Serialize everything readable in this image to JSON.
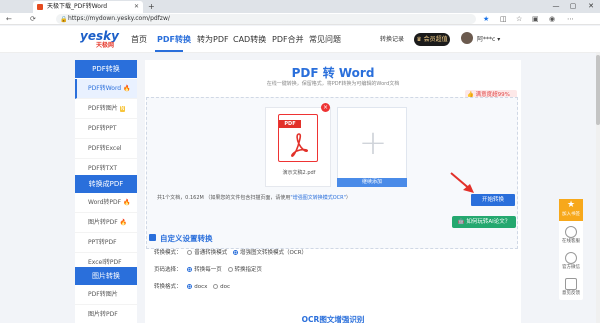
{
  "browser": {
    "tab_title": "天极下载_PDF转Word",
    "url": "https://mydown.yesky.com/pdfzw/",
    "new_tab_symbol": "+",
    "back_symbol": "←",
    "refresh_symbol": "⟳",
    "win_min": "—",
    "win_max": "▢",
    "win_close": "✕"
  },
  "logo": {
    "main": "yesky",
    "sub": "天极网"
  },
  "nav": {
    "items": [
      "首页",
      "PDF转换",
      "转为PDF",
      "CAD转换",
      "PDF合并",
      "常见问题"
    ],
    "active_index": 1,
    "conversion_record": "转换记录",
    "vip_label": "会员超值",
    "username": "阿***c"
  },
  "sidebar": {
    "groups": [
      {
        "title": "PDF转换",
        "items": [
          "PDF转Word",
          "PDF转图片",
          "PDF转PPT",
          "PDF转Excel",
          "PDF转TXT"
        ]
      },
      {
        "title": "转换成PDF",
        "items": [
          "Word转PDF",
          "图片转PDF",
          "PPT转PDF",
          "Excel转PDF"
        ]
      },
      {
        "title": "图片转换",
        "items": [
          "PDF转图片",
          "图片转PDF"
        ]
      }
    ],
    "hot_glyph": "🔥",
    "new_badge": "N"
  },
  "main": {
    "title": "PDF 转 Word",
    "subtitle": "在线一键转换，保留格式，将PDF转换为可编辑的Word文档",
    "satisfaction": "满意度超99%",
    "file": {
      "icon_label": "PDF",
      "name": "演示文稿2.pdf",
      "remove_symbol": "×"
    },
    "add_button": "继续添加",
    "add_symbol": "+",
    "summary_prefix": "共1个文档，0.162M （如果您的文件包含扫描页面，请使用",
    "summary_link": "\"增强图文转换模式OCR\"",
    "summary_suffix": "）",
    "start_button": "开始转换",
    "ai_button": "如何玩转AI论文？",
    "settings_title": "自定义设置转换",
    "conversion_mode_label": "转换模式：",
    "mode_options": [
      "普通转换模式",
      "增强图文转换模式（OCR）"
    ],
    "mode_selected": 1,
    "page_select_label": "页码选择：",
    "page_options": [
      "转换每一页",
      "转换指定页"
    ],
    "page_selected": 0,
    "format_label": "转换格式：",
    "format_options": [
      "docx",
      "doc"
    ],
    "format_selected": 0,
    "ocr_section_title": "OCR图文增强识别"
  },
  "float_bar": {
    "items": [
      "加入书签",
      "在线客服",
      "官方微信",
      "意见反馈"
    ]
  },
  "colors": {
    "primary": "#2a6fdb",
    "danger": "#e2312a",
    "green": "#24a86f",
    "vip": "#1b1b1b"
  }
}
